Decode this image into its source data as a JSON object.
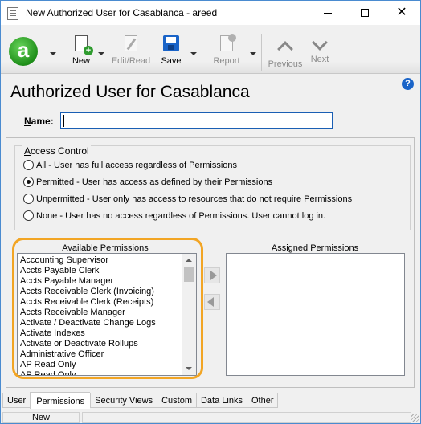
{
  "window": {
    "title": "New Authorized User for Casablanca - areed"
  },
  "toolbar": {
    "logo_letter": "a",
    "new_label": "New",
    "edit_read_label": "Edit/Read",
    "save_label": "Save",
    "report_label": "Report",
    "previous_label": "Previous",
    "next_label": "Next"
  },
  "page": {
    "title": "Authorized User for Casablanca",
    "help_glyph": "?"
  },
  "form": {
    "name_label_prefix": "N",
    "name_label_rest": "ame:",
    "name_value": ""
  },
  "access_control": {
    "title_prefix": "A",
    "title_rest": "ccess Control",
    "options": [
      {
        "label": "All - User has full access regardless of Permissions",
        "checked": false
      },
      {
        "label": "Permitted - User has access as defined by their Permissions",
        "checked": true
      },
      {
        "label": "Unpermitted - User only has access to resources that do not require Permissions",
        "checked": false
      },
      {
        "label": "None - User has no access regardless of Permissions. User cannot log in.",
        "checked": false
      }
    ]
  },
  "permissions": {
    "available_caption": "Available Permissions",
    "assigned_caption": "Assigned Permissions",
    "available": [
      "Accounting Supervisor",
      "Accts Payable Clerk",
      "Accts Payable Manager",
      "Accts Receivable Clerk (Invoicing)",
      "Accts Receivable Clerk (Receipts)",
      "Accts Receivable Manager",
      "Activate / Deactivate Change Logs",
      "Activate Indexes",
      "Activate or Deactivate Rollups",
      "Administrative Officer",
      "AP Read Only",
      "AP Read Only"
    ],
    "assigned": []
  },
  "tabs": [
    {
      "label": "User",
      "active": false
    },
    {
      "label": "Permissions",
      "active": true
    },
    {
      "label": "Security Views",
      "active": false
    },
    {
      "label": "Custom",
      "active": false
    },
    {
      "label": "Data Links",
      "active": false
    },
    {
      "label": "Other",
      "active": false
    }
  ],
  "status": {
    "mode": "New"
  },
  "colors": {
    "highlight": "#f2a524",
    "accent": "#1a64c8"
  }
}
